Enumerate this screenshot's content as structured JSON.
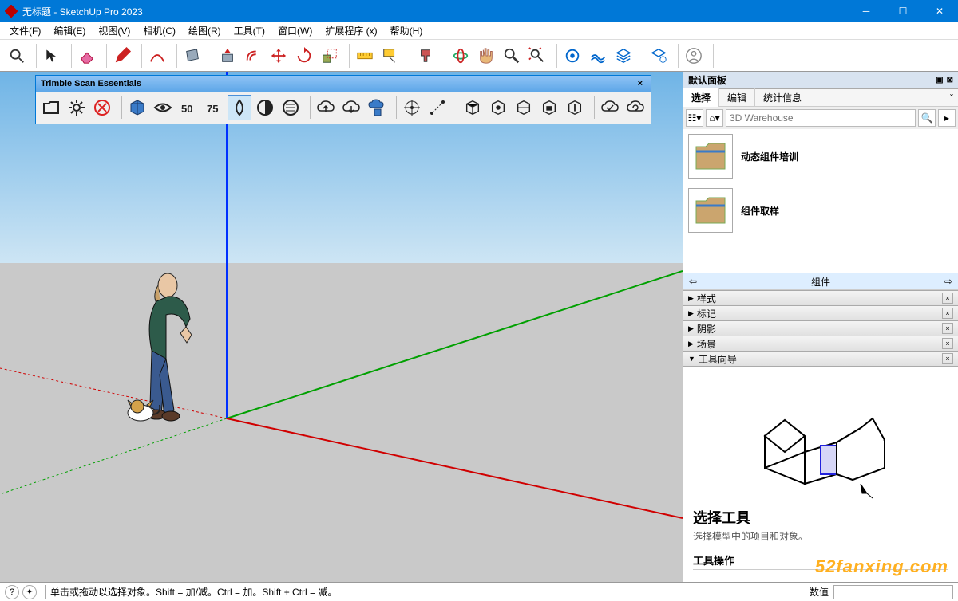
{
  "window": {
    "title": "无标题 - SketchUp Pro 2023"
  },
  "menu": [
    "文件(F)",
    "编辑(E)",
    "视图(V)",
    "相机(C)",
    "绘图(R)",
    "工具(T)",
    "窗口(W)",
    "扩展程序 (x)",
    "帮助(H)"
  ],
  "scan_toolbar": {
    "title": "Trimble Scan Essentials"
  },
  "panel": {
    "header": "默认面板",
    "tabs": {
      "select": "选择",
      "edit": "编辑",
      "stats": "统计信息"
    },
    "search_placeholder": "3D Warehouse",
    "items": [
      {
        "label": "动态组件培训"
      },
      {
        "label": "组件取样"
      }
    ],
    "nav_label": "组件",
    "sections": [
      "样式",
      "标记",
      "阴影",
      "场景",
      "工具向导"
    ],
    "guide": {
      "title": "选择工具",
      "desc": "选择模型中的项目和对象。",
      "sub": "工具操作"
    }
  },
  "status": {
    "hint": "单击或拖动以选择对象。Shift = 加/减。Ctrl = 加。Shift + Ctrl = 减。",
    "value_label": "数值"
  },
  "watermark": "52fanxing.com"
}
